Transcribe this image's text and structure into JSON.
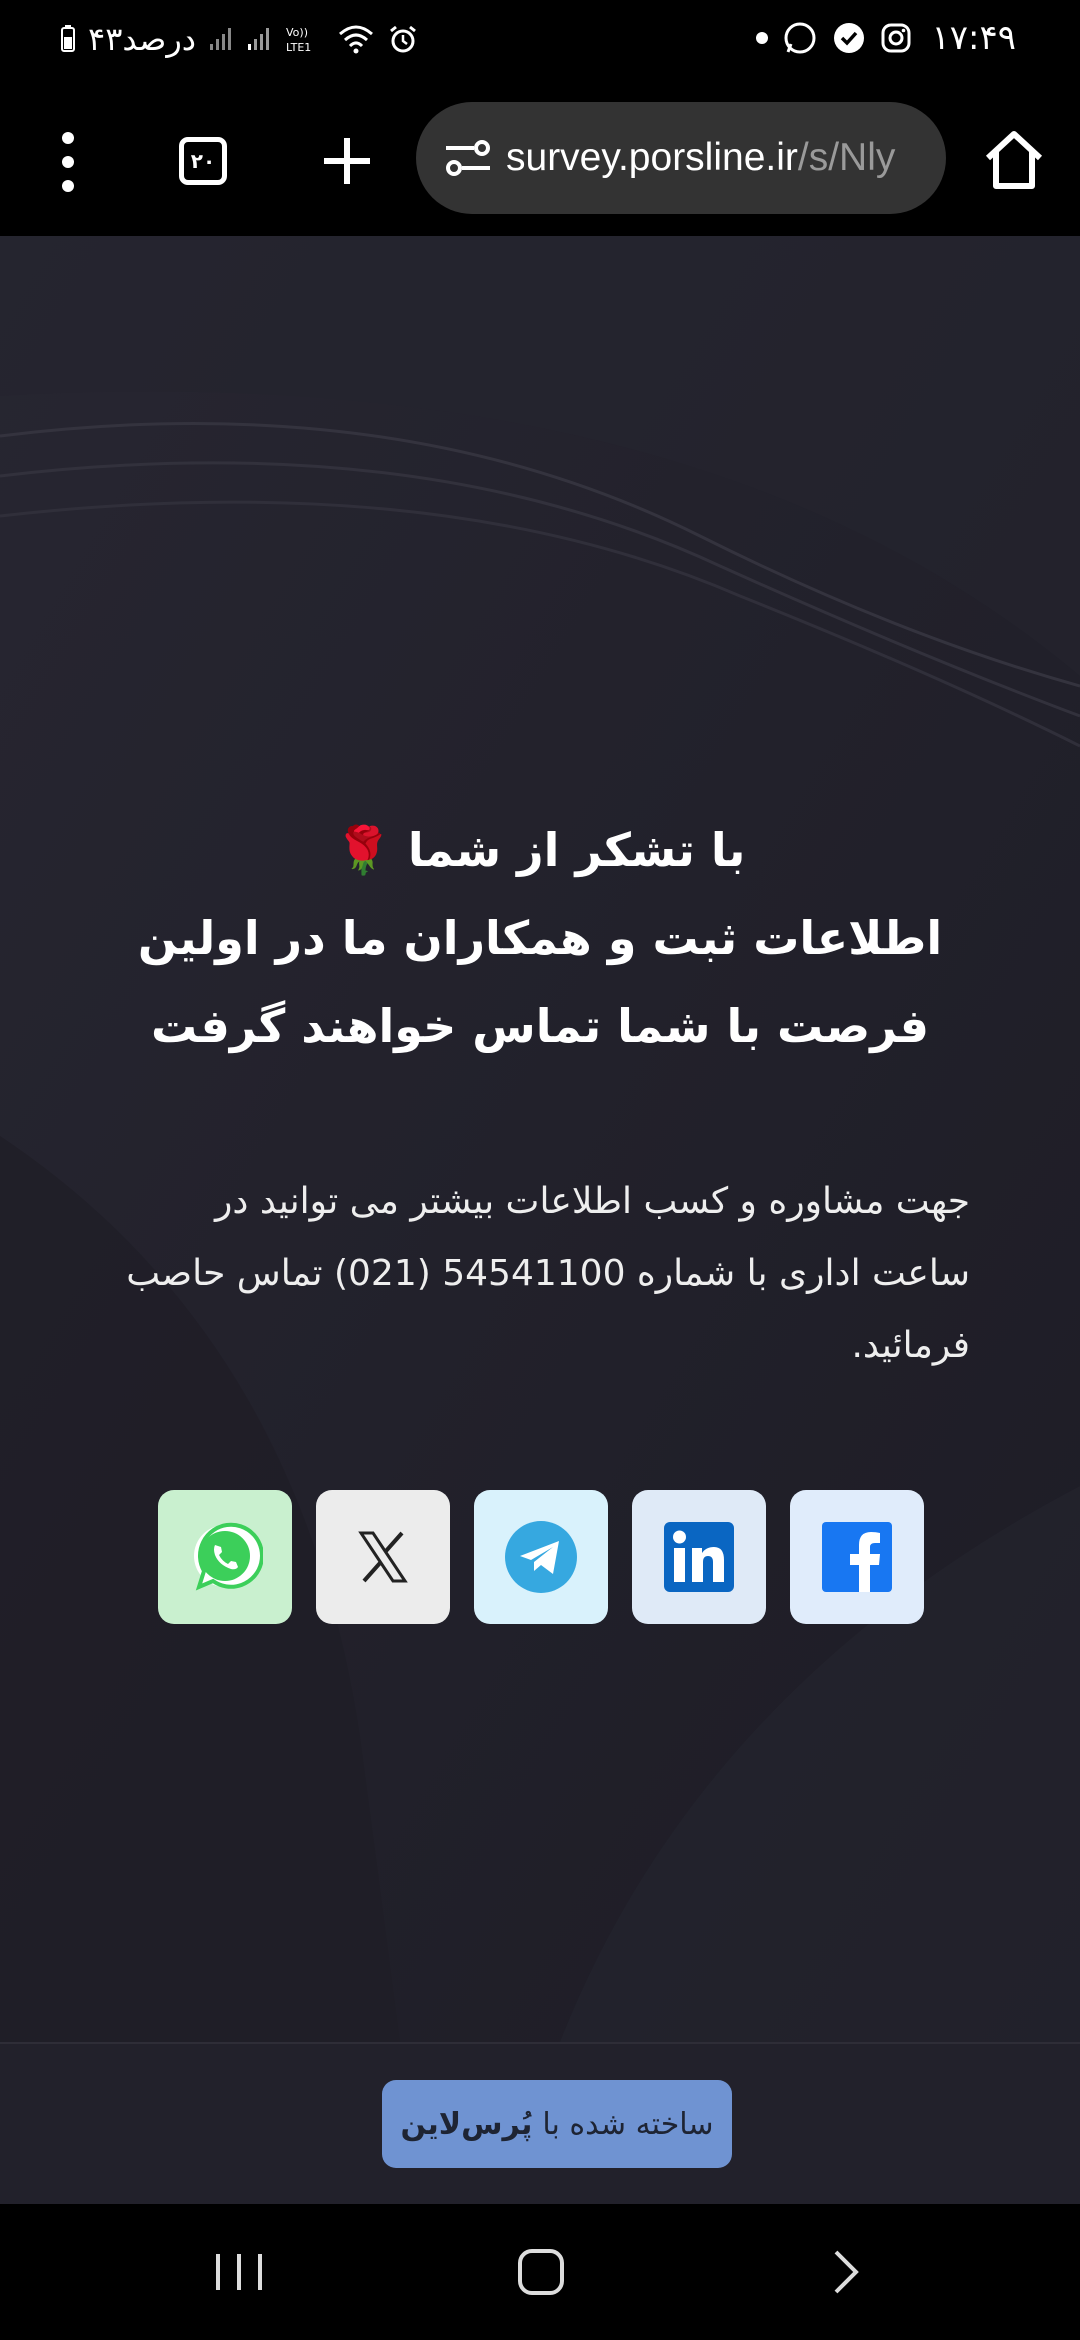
{
  "status_bar": {
    "time": "۱۷:۴۹",
    "battery": "۴۳درصد",
    "network_label": "Vo) LTE1"
  },
  "browser": {
    "tab_count": "۲۰",
    "url_domain": "survey.porsline.ir",
    "url_path": "/s/Nly"
  },
  "content": {
    "heading_line1": "با تشکر از شما 🌹",
    "heading_line2": "اطلاعات ثبت و همکاران ما در اولین",
    "heading_line3": "فرصت با شما تماس خواهند گرفت",
    "contact_text": "جهت مشاوره و کسب اطلاعات بیشتر می توانید در ساعت اداری با شماره  54541100 (021)  تماس حاصب فرمائید."
  },
  "social": {
    "icons": [
      "whatsapp-icon",
      "x-icon",
      "telegram-icon",
      "linkedin-icon",
      "facebook-icon"
    ],
    "colors": {
      "whatsapp_bg": "#c9f0cf",
      "x_bg": "#ececec",
      "telegram_bg": "#d9f2fc",
      "linkedin_bg": "#dfeaf7",
      "facebook_bg": "#e0ecfb"
    }
  },
  "footer": {
    "powered_prefix": "ساخته شده با",
    "powered_brand": "پُرس‌لاین"
  },
  "theme": {
    "page_bg": "#22212b",
    "badge_bg": "#6f93d2"
  }
}
